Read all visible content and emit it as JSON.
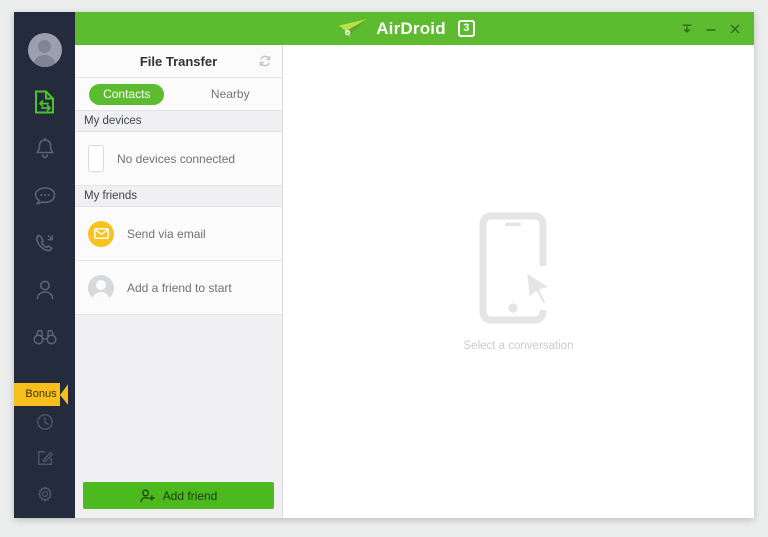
{
  "window": {
    "brand_name": "AirDroid",
    "brand_badge": "3",
    "controls": [
      {
        "name": "minimize-to-tray-button",
        "glyph": "tray-arrow-icon"
      },
      {
        "name": "minimize-button",
        "glyph": "minimize-icon"
      },
      {
        "name": "close-button",
        "glyph": "close-icon"
      }
    ],
    "accent_green": "#5cbb2e",
    "rail_dark": "#242b3d",
    "bonus_yellow": "#f7bf1c"
  },
  "rail": {
    "avatar_label": "avatar",
    "items": [
      {
        "icon": "file-transfer-icon",
        "name": "rail-item-file-transfer",
        "active": true
      },
      {
        "icon": "bell-icon",
        "name": "rail-item-notifications",
        "active": false
      },
      {
        "icon": "chat-bubble-icon",
        "name": "rail-item-messages",
        "active": false
      },
      {
        "icon": "phone-call-icon",
        "name": "rail-item-calls",
        "active": false
      },
      {
        "icon": "person-icon",
        "name": "rail-item-contacts",
        "active": false
      },
      {
        "icon": "binoculars-icon",
        "name": "rail-item-find-phone",
        "active": false
      }
    ],
    "bonus_label": "Bonus",
    "bottom_items": [
      {
        "icon": "clock-icon",
        "name": "rail-item-history"
      },
      {
        "icon": "compose-icon",
        "name": "rail-item-compose"
      },
      {
        "icon": "gear-icon",
        "name": "rail-item-settings"
      }
    ]
  },
  "panel": {
    "title": "File Transfer",
    "refresh_icon": "refresh-icon",
    "tabs": [
      {
        "label": "Contacts",
        "active": true
      },
      {
        "label": "Nearby",
        "active": false
      }
    ],
    "sections": [
      {
        "header": "My devices",
        "rows": [
          {
            "icon": "phone-icon",
            "label": "No devices connected"
          }
        ]
      },
      {
        "header": "My friends",
        "rows": [
          {
            "icon": "envelope-icon",
            "label": "Send via email"
          },
          {
            "icon": "avatar-icon",
            "label": "Add a friend to start"
          }
        ]
      }
    ],
    "add_friend_label": "Add friend",
    "add_friend_icon": "person-plus-icon"
  },
  "main": {
    "empty_icon": "phone-cursor-icon",
    "empty_text": "Select a conversation"
  }
}
